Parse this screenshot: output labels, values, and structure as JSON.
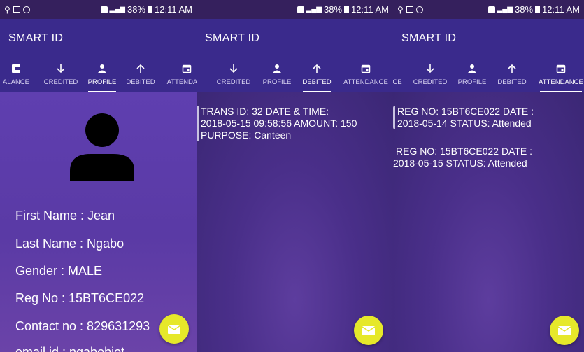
{
  "status": {
    "time": "12:11 AM",
    "battery": "38%",
    "signal": "4G"
  },
  "app_title": "SMART ID",
  "tabs": {
    "balance": "ALANCE",
    "credited": "CREDITED",
    "profile": "PROFILE",
    "debited": "DEBITED",
    "attendance": "ATTENDACE",
    "attendance_full": "ATTENDANCE",
    "cut_left": "CE"
  },
  "profile": {
    "first_name": "First Name :  Jean",
    "last_name": "Last Name :  Ngabo",
    "gender": "Gender      : MALE",
    "reg_no": "Reg No     :  15BT6CE022",
    "contact": "Contact no : 829631293",
    "email": "email id      : ngabobiot"
  },
  "debited": {
    "line1": "TRANS ID: 32  DATE & TIME:",
    "line2": "2018-05-15 09:58:56   AMOUNT: 150",
    "line3": "PURPOSE: Canteen"
  },
  "attendance": [
    {
      "line1": "REG NO: 15BT6CE022  DATE :",
      "line2": "2018-05-14  STATUS: Attended"
    },
    {
      "line1": "REG NO: 15BT6CE022  DATE :",
      "line2": "2018-05-15  STATUS: Attended"
    }
  ]
}
